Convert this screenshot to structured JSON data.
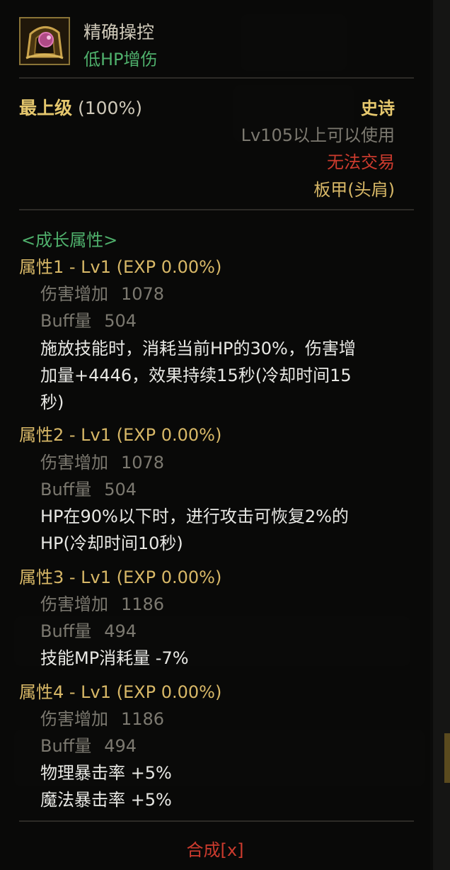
{
  "item": {
    "name": "精确操控",
    "subtitle": "低HP增伤",
    "grade_label": "最上级",
    "grade_value": "(100%)",
    "rarity": "史诗",
    "level_req": "Lv105以上可以使用",
    "trade": "无法交易",
    "type": "板甲(头肩)"
  },
  "growth_header": "<成长属性>",
  "attributes": [
    {
      "title": "属性1 - Lv1 (EXP 0.00%)",
      "damage_label": "伤害增加",
      "damage_value": "1078",
      "buff_label": "Buff量",
      "buff_value": "504",
      "desc_lines": [
        "施放技能时，消耗当前HP的30%，伤害增",
        "加量+4446，效果持续15秒(冷却时间15",
        "秒)"
      ]
    },
    {
      "title": "属性2 - Lv1 (EXP 0.00%)",
      "damage_label": "伤害增加",
      "damage_value": "1078",
      "buff_label": "Buff量",
      "buff_value": "504",
      "desc_lines": [
        "HP在90%以下时，进行攻击可恢复2%的",
        "HP(冷却时间10秒)"
      ]
    },
    {
      "title": "属性3 - Lv1 (EXP 0.00%)",
      "damage_label": "伤害增加",
      "damage_value": "1186",
      "buff_label": "Buff量",
      "buff_value": "494",
      "desc_lines": [
        "技能MP消耗量 -7%"
      ]
    },
    {
      "title": "属性4 - Lv1 (EXP 0.00%)",
      "damage_label": "伤害增加",
      "damage_value": "1186",
      "buff_label": "Buff量",
      "buff_value": "494",
      "desc_lines": [
        "物理暴击率 +5%",
        "魔法暴击率 +5%"
      ]
    }
  ],
  "footer": {
    "merge": "合成[x]"
  },
  "colors": {
    "gold": "#d8b867",
    "green": "#4fb06c",
    "red": "#cc3b2e",
    "grey": "#7c7970",
    "white": "#e8e8e4"
  },
  "icons": {
    "item_icon": "epic-helmet-shoulder-icon"
  }
}
